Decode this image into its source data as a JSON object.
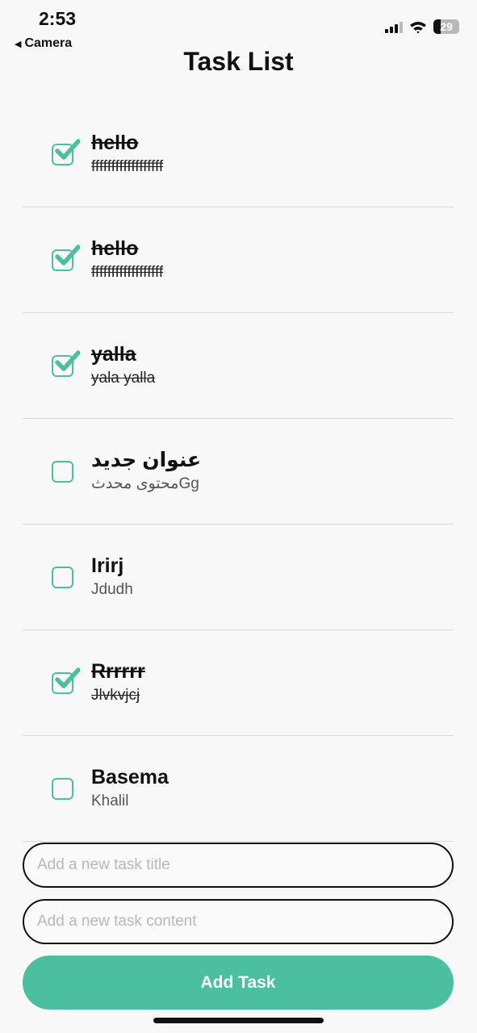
{
  "status_bar": {
    "time": "2:53",
    "back_label": "Camera",
    "battery": "29"
  },
  "header": {
    "title": "Task List"
  },
  "tasks": [
    {
      "title": "hello",
      "content": "ffffffffffffffffff",
      "done": true
    },
    {
      "title": "hello",
      "content": "ffffffffffffffffff",
      "done": true
    },
    {
      "title": "yalla",
      "content": "yala yalla",
      "done": true
    },
    {
      "title": "عنوان جديد",
      "content": "محتوى محدثGg",
      "done": false
    },
    {
      "title": "Irirj",
      "content": "Jdudh",
      "done": false
    },
    {
      "title": "Rrrrrr",
      "content": "Jlvkvjcj",
      "done": true
    },
    {
      "title": "Basema",
      "content": "Khalil",
      "done": false
    }
  ],
  "form": {
    "title_placeholder": "Add a new task title",
    "title_value": "",
    "content_placeholder": "Add a new task content",
    "content_value": "",
    "add_label": "Add Task"
  },
  "colors": {
    "accent": "#4bbf9f",
    "background": "#f8f8f8",
    "divider": "#d8d8d8"
  }
}
